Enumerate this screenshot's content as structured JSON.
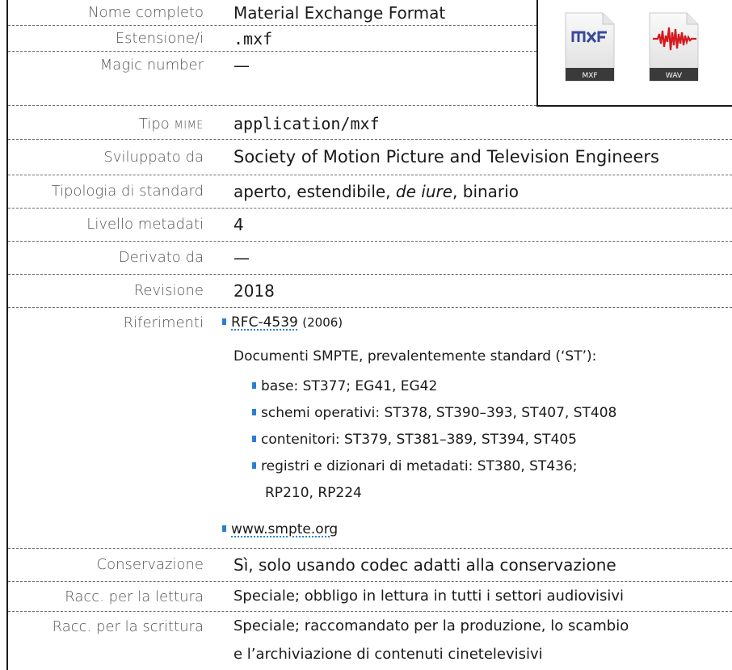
{
  "rows": {
    "nome": {
      "label": "Nome completo",
      "value": "Material Exchange Format"
    },
    "estensione": {
      "label": "Estensione/i",
      "value": ".mxf"
    },
    "magic": {
      "label": "Magic number",
      "value": "—"
    },
    "mime": {
      "label_pre": "Tipo ",
      "label_sc": "MIME",
      "value": "application/mxf"
    },
    "sviluppato": {
      "label": "Sviluppato da",
      "value": "Society of Motion Picture and Television Engineers"
    },
    "tipologia": {
      "label": "Tipologia di standard",
      "value_a": "aperto, estendibile, ",
      "value_b": "de iure",
      "value_c": ", binario"
    },
    "livello": {
      "label": "Livello metadati",
      "value": "4"
    },
    "derivato": {
      "label": "Derivato da",
      "value": "—"
    },
    "revisione": {
      "label": "Revisione",
      "value": "2018"
    },
    "riferimenti": {
      "label": "Riferimenti",
      "rfc_link": "RFC-4539",
      "rfc_year": "(2006)",
      "doc_intro": "Documenti SMPTE, prevalentemente standard (‘ST’):",
      "items": [
        {
          "text": "base:  ST377;  EG41, EG42"
        },
        {
          "text": "schemi operativi:  ST378, ST390–393, ST407, ST408"
        },
        {
          "text": "contenitori:  ST379, ST381–389, ST394, ST405"
        },
        {
          "text": "registri e dizionari di metadati:  ST380, ST436;"
        },
        {
          "text": "RP210, RP224"
        }
      ],
      "site_link": "www.smpte.org"
    },
    "conservazione": {
      "label": "Conservazione",
      "value": "Sì, solo usando codec adatti alla conservazione"
    },
    "lettura": {
      "label": "Racc. per la lettura",
      "value": "Speciale; obbligo in lettura in tutti i settori audiovisivi"
    },
    "scrittura": {
      "label": "Racc. per la scrittura",
      "value_1": "Speciale; raccomandato per la produzione, lo scambio",
      "value_2": "e l’archiviazione di contenuti cinetelevisivi"
    }
  },
  "icons": {
    "mxf": {
      "name": "mxf-file-icon",
      "badge": "MXF",
      "logo": "MXF",
      "accent": "#3a4a9a"
    },
    "wav": {
      "name": "wav-file-icon",
      "badge": "WAV",
      "accent": "#d4181e"
    }
  },
  "colors": {
    "bullet": "#2a7fd4",
    "label": "#555555",
    "text": "#1a1a1a",
    "divider": "#6b6b6b"
  }
}
